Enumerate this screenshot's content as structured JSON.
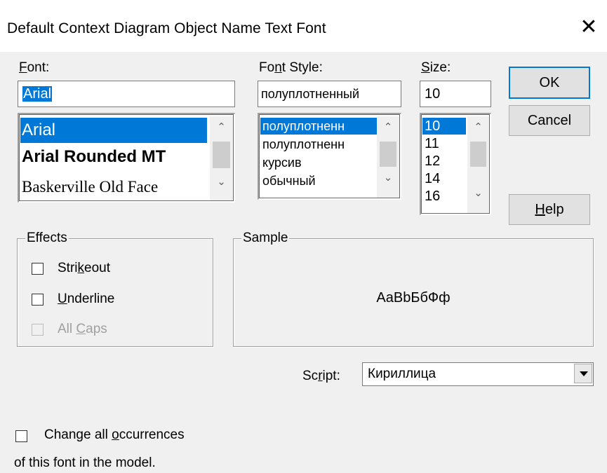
{
  "dialog": {
    "title": "Default Context Diagram Object Name Text Font",
    "close_glyph": "✕"
  },
  "font": {
    "label_ul": "F",
    "label_rest": "ont:",
    "input_value": "Arial",
    "items": [
      "Arial",
      "Arial Rounded MT",
      "Baskerville Old Face"
    ],
    "selected_index": 0
  },
  "font_style": {
    "label_a": "Fo",
    "label_ul": "n",
    "label_b": "t Style:",
    "input_value": "полуплотненный",
    "items": [
      "полуплотненн",
      "полуплотненн",
      "курсив",
      "обычный"
    ],
    "selected_index": 0
  },
  "size": {
    "label_ul": "S",
    "label_rest": "ize:",
    "input_value": "10",
    "items": [
      "10",
      "11",
      "12",
      "14",
      "16"
    ],
    "selected_index": 0
  },
  "buttons": {
    "ok": "OK",
    "cancel": "Cancel",
    "help_ul": "H",
    "help_rest": "elp"
  },
  "effects": {
    "legend": "Effects",
    "strikeout_a": "Stri",
    "strikeout_ul": "k",
    "strikeout_b": "eout",
    "underline_ul": "U",
    "underline_rest": "nderline",
    "allcaps_a": "All ",
    "allcaps_ul": "C",
    "allcaps_b": "aps"
  },
  "sample": {
    "legend": "Sample",
    "text": "AaBbБбФф"
  },
  "script": {
    "label_a": "Sc",
    "label_ul": "r",
    "label_b": "ipt:",
    "value": "Кириллица"
  },
  "change_all": {
    "line1_a": "Change all ",
    "line1_ul": "o",
    "line1_b": "ccurrences",
    "line2": "of this font in the model."
  },
  "icons": {
    "scroll_up": "⌃",
    "scroll_down": "⌄"
  }
}
